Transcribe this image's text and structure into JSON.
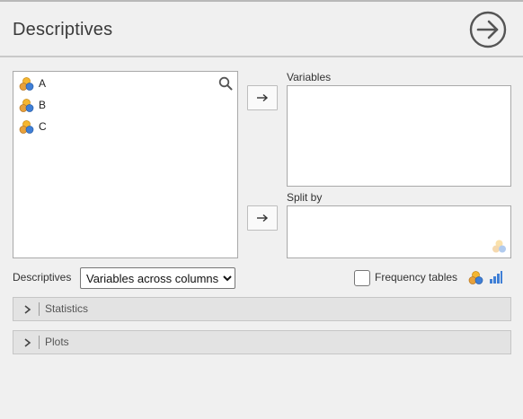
{
  "header": {
    "title": "Descriptives"
  },
  "source": {
    "variables": [
      {
        "name": "A",
        "icon": "nominal-icon"
      },
      {
        "name": "B",
        "icon": "nominal-icon"
      },
      {
        "name": "C",
        "icon": "nominal-icon"
      }
    ]
  },
  "targets": {
    "variables_label": "Variables",
    "split_by_label": "Split by"
  },
  "options": {
    "descriptives_label": "Descriptives",
    "descriptives_select": {
      "selected": "Variables across columns"
    },
    "frequency_tables_label": "Frequency tables",
    "frequency_tables_checked": false
  },
  "sections": [
    {
      "label": "Statistics",
      "expanded": false
    },
    {
      "label": "Plots",
      "expanded": false
    }
  ],
  "colors": {
    "nominal_top": "#f5b630",
    "nominal_left": "#e8a13a",
    "nominal_right": "#3f7fd6",
    "bar_icon": "#3f7fd6",
    "run_icon": "#555555"
  }
}
